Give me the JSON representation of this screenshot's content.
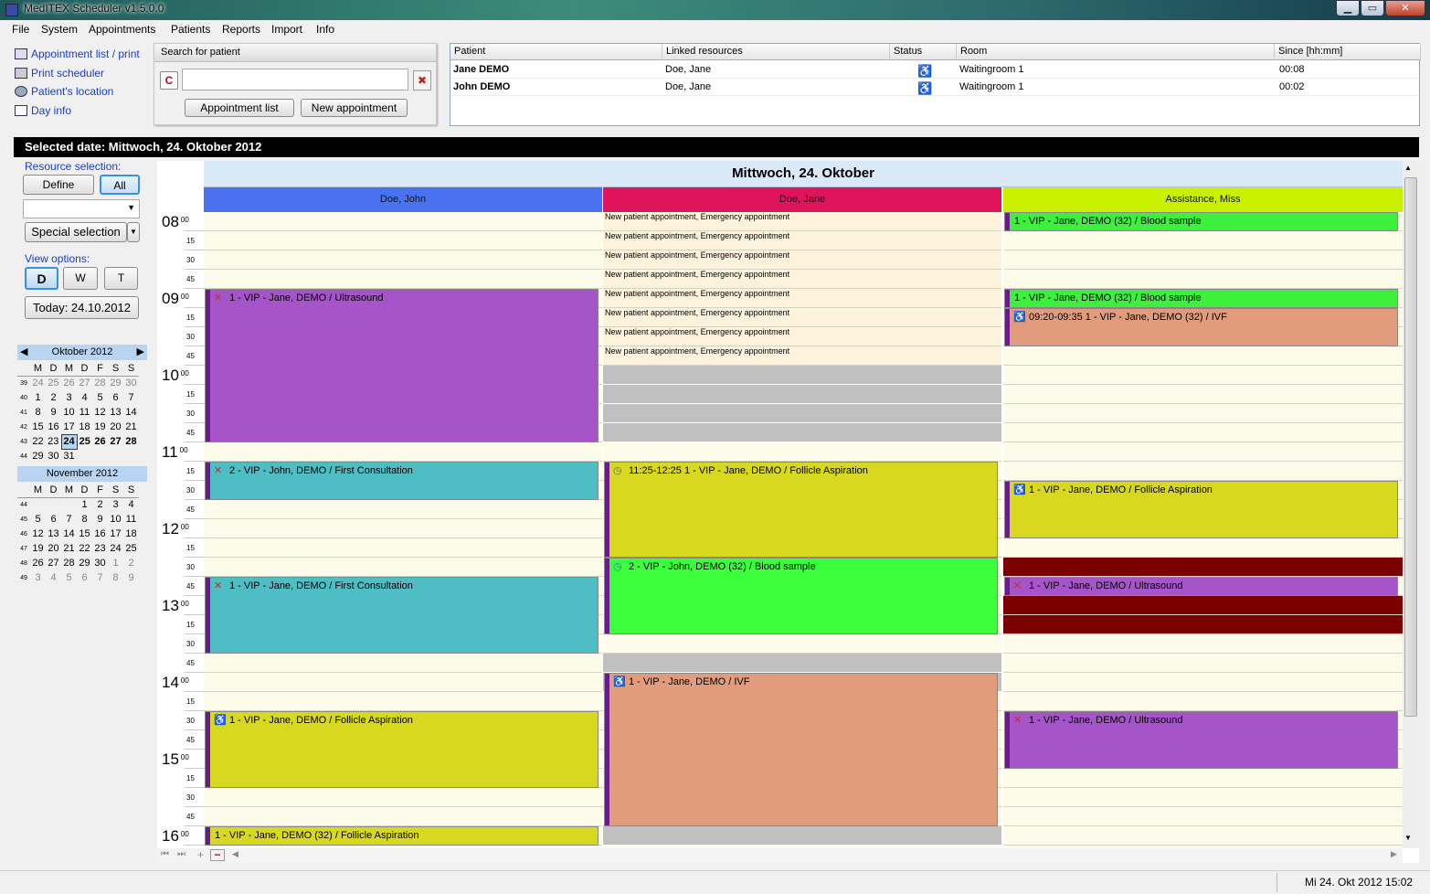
{
  "window": {
    "title": "MedITEX  Scheduler v1.5.0.0",
    "min_label": "▁",
    "max_label": "▭",
    "close_label": "✕"
  },
  "menu": [
    "File",
    "System",
    "Appointments",
    "Patients",
    "Reports",
    "Import",
    "Info"
  ],
  "quicklinks": [
    "Appointment list / print",
    "Print scheduler",
    "Patient's location",
    "Day info"
  ],
  "search": {
    "header": "Search for patient",
    "value": "",
    "btn_list": "Appointment list",
    "btn_new": "New appointment"
  },
  "waitlist": {
    "headers": [
      "Patient",
      "Linked resources",
      "Status",
      "Room",
      "Since [hh:mm]"
    ],
    "rows": [
      {
        "patient": "Jane DEMO",
        "resources": "Doe, Jane",
        "status": "waiting-icon",
        "room": "Waitingroom 1",
        "since": "00:08"
      },
      {
        "patient": "John DEMO",
        "resources": "Doe, Jane",
        "status": "waiting-icon",
        "room": "Waitingroom 1",
        "since": "00:02"
      }
    ]
  },
  "selected_date": "Selected date: Mittwoch, 24. Oktober 2012",
  "left": {
    "resource_selection": "Resource selection:",
    "define": "Define",
    "all": "All",
    "dropdown_value": "",
    "special": "Special selection",
    "view_options": "View options:",
    "views": [
      "D",
      "W",
      "T"
    ],
    "today": "Today: 24.10.2012",
    "oct_title": "Oktober 2012",
    "nov_title": "November 2012",
    "weekdays": [
      "M",
      "D",
      "M",
      "D",
      "F",
      "S",
      "S"
    ],
    "oct_weeks": [
      [
        "39",
        "24",
        "25",
        "26",
        "27",
        "28",
        "29",
        "30"
      ],
      [
        "40",
        "1",
        "2",
        "3",
        "4",
        "5",
        "6",
        "7"
      ],
      [
        "41",
        "8",
        "9",
        "10",
        "11",
        "12",
        "13",
        "14"
      ],
      [
        "42",
        "15",
        "16",
        "17",
        "18",
        "19",
        "20",
        "21"
      ],
      [
        "43",
        "22",
        "23",
        "24",
        "25",
        "26",
        "27",
        "28"
      ],
      [
        "44",
        "29",
        "30",
        "31",
        "",
        "",
        "",
        ""
      ]
    ],
    "nov_weeks": [
      [
        "44",
        "",
        "",
        "",
        "1",
        "2",
        "3",
        "4"
      ],
      [
        "45",
        "5",
        "6",
        "7",
        "8",
        "9",
        "10",
        "11"
      ],
      [
        "46",
        "12",
        "13",
        "14",
        "15",
        "16",
        "17",
        "18"
      ],
      [
        "47",
        "19",
        "20",
        "21",
        "22",
        "23",
        "24",
        "25"
      ],
      [
        "48",
        "26",
        "27",
        "28",
        "29",
        "30",
        "1",
        "2"
      ],
      [
        "49",
        "3",
        "4",
        "5",
        "6",
        "7",
        "8",
        "9"
      ]
    ]
  },
  "schedule": {
    "day_title": "Mittwoch, 24. Oktober",
    "resources": [
      {
        "name": "Doe, John",
        "color": "#4a72f0"
      },
      {
        "name": "Doe, Jane",
        "color": "#e0145a"
      },
      {
        "name": "Assistance, Miss",
        "color": "#c8f000"
      }
    ],
    "hours": [
      "08",
      "09",
      "10",
      "11",
      "12",
      "13",
      "14",
      "15",
      "16"
    ],
    "hour_sup": "00",
    "minutes": [
      "15",
      "30",
      "45"
    ],
    "emergency_text": "New patient appointment, Emergency appointment",
    "appointments": {
      "a1": "1 - VIP - Jane, DEMO / Ultrasound",
      "a2": "2 - VIP - John, DEMO / First Consultation",
      "a3": "1 - VIP - Jane, DEMO / First Consultation",
      "a4": "1 - VIP - Jane, DEMO / Follicle Aspiration",
      "a5": "1 - VIP - Jane, DEMO (32) / Follicle Aspiration",
      "b1": "11:25-12:25 1 - VIP - Jane, DEMO / Follicle Aspiration",
      "b2": "2 - VIP - John, DEMO (32) / Blood sample",
      "b3": "1 - VIP - Jane, DEMO / IVF",
      "c1": "1 - VIP - Jane, DEMO (32) / Blood sample",
      "c2": "1 - VIP - Jane, DEMO (32) / Blood sample",
      "c3": "09:20-09:35 1 - VIP - Jane, DEMO (32) / IVF",
      "c4": "1 - VIP - Jane, DEMO / Follicle Aspiration",
      "c5": "1 - VIP - Jane, DEMO / Ultrasound",
      "c6": "1 - VIP - Jane, DEMO / Ultrasound"
    }
  },
  "status": "Mi 24. Okt 2012 15:02"
}
